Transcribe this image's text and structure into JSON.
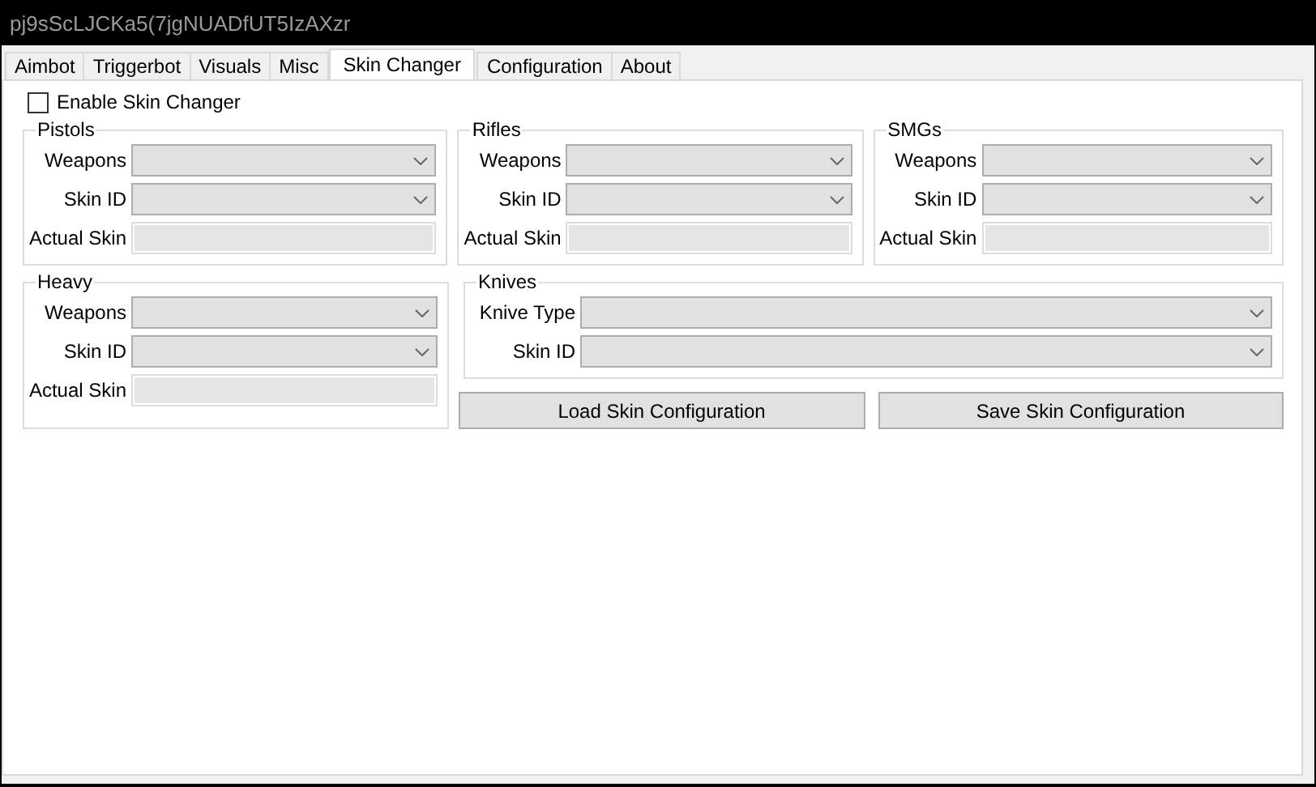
{
  "window": {
    "title": "pj9sScLJCKa5(7jgNUADfUT5IzAXzr"
  },
  "tabs": [
    {
      "label": "Aimbot",
      "selected": false
    },
    {
      "label": "Triggerbot",
      "selected": false
    },
    {
      "label": "Visuals",
      "selected": false
    },
    {
      "label": "Misc",
      "selected": false
    },
    {
      "label": "Skin Changer",
      "selected": true
    },
    {
      "label": "Configuration",
      "selected": false
    },
    {
      "label": "About",
      "selected": false
    }
  ],
  "enable_checkbox": {
    "label": "Enable Skin Changer",
    "checked": false
  },
  "groups": [
    {
      "title": "Pistols",
      "fields": [
        {
          "label": "Weapons",
          "kind": "combo"
        },
        {
          "label": "Skin ID",
          "kind": "combo"
        },
        {
          "label": "Actual Skin",
          "kind": "text"
        }
      ]
    },
    {
      "title": "Rifles",
      "fields": [
        {
          "label": "Weapons",
          "kind": "combo"
        },
        {
          "label": "Skin ID",
          "kind": "combo"
        },
        {
          "label": "Actual Skin",
          "kind": "text"
        }
      ]
    },
    {
      "title": "SMGs",
      "fields": [
        {
          "label": "Weapons",
          "kind": "combo"
        },
        {
          "label": "Skin ID",
          "kind": "combo"
        },
        {
          "label": "Actual Skin",
          "kind": "text"
        }
      ]
    },
    {
      "title": "Heavy",
      "fields": [
        {
          "label": "Weapons",
          "kind": "combo"
        },
        {
          "label": "Skin ID",
          "kind": "combo"
        },
        {
          "label": "Actual Skin",
          "kind": "text"
        }
      ]
    }
  ],
  "knives": {
    "title": "Knives",
    "fields": [
      {
        "label": "Knive Type",
        "kind": "combo"
      },
      {
        "label": "Skin ID",
        "kind": "combo"
      }
    ]
  },
  "buttons": [
    "Load Skin Configuration",
    "Save Skin Configuration"
  ]
}
